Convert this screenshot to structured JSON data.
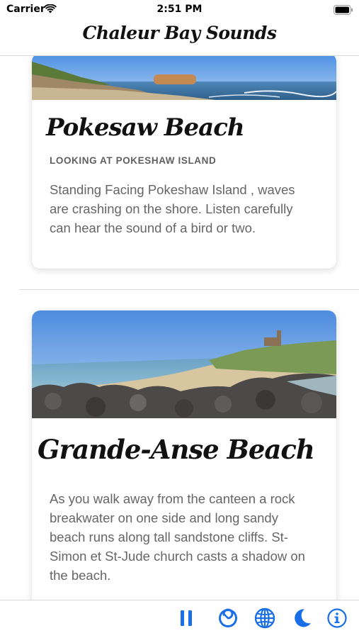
{
  "status_bar": {
    "carrier": "Carrier",
    "time": "2:51 PM",
    "wifi_icon": "wifi-icon",
    "battery_icon": "battery-icon"
  },
  "header": {
    "title": "Chaleur Bay Sounds"
  },
  "cards": [
    {
      "image_name": "beach-panorama-image",
      "title": "Pokesaw Beach",
      "subtitle": "LOOKING AT POKESHAW ISLAND",
      "description": "Standing Facing Pokeshaw Island , waves are crashing on the shore. Listen carefully can hear the sound of a bird or two."
    },
    {
      "image_name": "beach-panorama-image",
      "title": "Grande-Anse Beach",
      "description": "As you walk away from the canteen a rock breakwater on one side and long sandy beach runs along tall sandstone cliffs. St-Simon et St-Jude church casts a shadow on the beach."
    }
  ],
  "toolbar": {
    "buttons": [
      {
        "icon": "pause-icon"
      },
      {
        "icon": "timer-icon"
      },
      {
        "icon": "globe-icon"
      },
      {
        "icon": "moon-icon"
      },
      {
        "icon": "info-icon"
      }
    ]
  },
  "colors": {
    "accent": "#1a6fe8",
    "text_primary": "#111111",
    "text_secondary": "#666666",
    "subtitle": "#606060"
  }
}
